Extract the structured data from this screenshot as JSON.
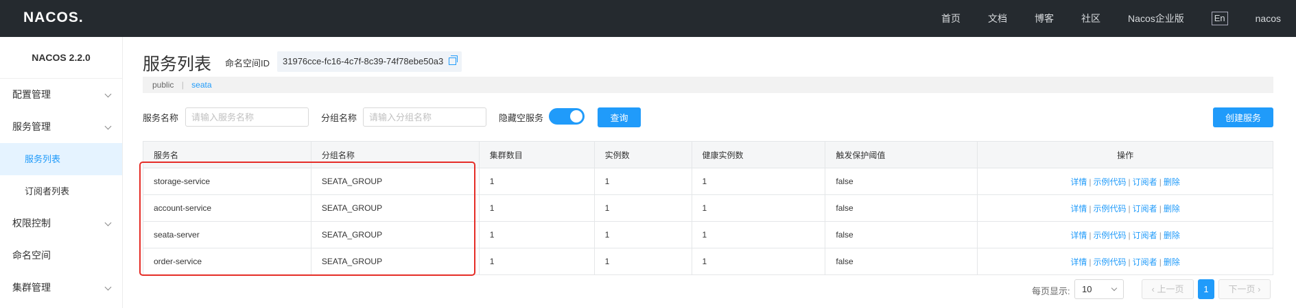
{
  "topbar": {
    "logo": "NACOS.",
    "nav": [
      "首页",
      "文档",
      "博客",
      "社区",
      "Nacos企业版"
    ],
    "lang": "En",
    "user": "nacos"
  },
  "sidebar": {
    "version": "NACOS 2.2.0",
    "items": [
      {
        "label": "配置管理",
        "chevron": true
      },
      {
        "label": "服务管理",
        "chevron": true
      },
      {
        "label": "服务列表",
        "sub": true,
        "active": true
      },
      {
        "label": "订阅者列表",
        "sub": true
      },
      {
        "label": "权限控制",
        "chevron": true
      },
      {
        "label": "命名空间",
        "chevron": false
      },
      {
        "label": "集群管理",
        "chevron": true
      }
    ]
  },
  "main": {
    "title": "服务列表",
    "namespace_label": "命名空间ID",
    "namespace_id": "31976cce-fc16-4c7f-8c39-74f78ebe50a3",
    "namespaces": {
      "public": "public",
      "sep": "|",
      "seata": "seata"
    },
    "filters": {
      "service_name_label": "服务名称",
      "service_name_placeholder": "请输入服务名称",
      "group_name_label": "分组名称",
      "group_name_placeholder": "请输入分组名称",
      "hide_empty_label": "隐藏空服务",
      "hide_empty_on": true,
      "query_button": "查询",
      "create_button": "创建服务"
    },
    "table": {
      "headers": [
        "服务名",
        "分组名称",
        "集群数目",
        "实例数",
        "健康实例数",
        "触发保护阈值",
        "操作"
      ],
      "rows": [
        [
          "storage-service",
          "SEATA_GROUP",
          "1",
          "1",
          "1",
          "false"
        ],
        [
          "account-service",
          "SEATA_GROUP",
          "1",
          "1",
          "1",
          "false"
        ],
        [
          "seata-server",
          "SEATA_GROUP",
          "1",
          "1",
          "1",
          "false"
        ],
        [
          "order-service",
          "SEATA_GROUP",
          "1",
          "1",
          "1",
          "false"
        ]
      ],
      "actions": [
        "详情",
        "示例代码",
        "订阅者",
        "删除"
      ]
    },
    "pager": {
      "per_page_label": "每页显示:",
      "per_page": "10",
      "prev": "上一页",
      "current": "1",
      "next": "下一页"
    }
  },
  "colors": {
    "accent": "#209bfa",
    "topbar": "#252a2f",
    "highlight_box": "#e52b25"
  }
}
